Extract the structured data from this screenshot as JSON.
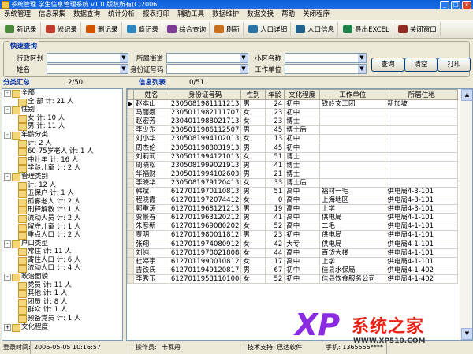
{
  "window": {
    "title": "系统管理 学生信息管理系统 v1.0 版权所有(C)2006"
  },
  "menu": [
    "系统管理",
    "信息采集",
    "数据查询",
    "统计分析",
    "报表打印",
    "辅助工具",
    "数据维护",
    "数据交换",
    "帮助",
    "关闭程序"
  ],
  "toolbar": [
    {
      "label": "新记录",
      "icon": "new-record-icon",
      "color": "#4a8a3a"
    },
    {
      "label": "修记录",
      "icon": "edit-record-icon",
      "color": "#c0392b"
    },
    {
      "label": "删记录",
      "icon": "delete-record-icon",
      "color": "#d35400"
    },
    {
      "label": "简记录",
      "icon": "brief-record-icon",
      "color": "#2e86c1"
    },
    {
      "label": "综合查询",
      "icon": "search-icon",
      "color": "#7d3c98"
    },
    {
      "label": "刷新",
      "icon": "refresh-icon",
      "color": "#ca6f1e"
    },
    {
      "label": "人口详细",
      "icon": "person-detail-icon",
      "color": "#2874a6"
    },
    {
      "label": "人口信息",
      "icon": "person-info-icon",
      "color": "#1f618d"
    },
    {
      "label": "导出EXCEL",
      "icon": "excel-icon",
      "color": "#1e8449"
    },
    {
      "label": "关闭窗口",
      "icon": "close-window-icon",
      "color": "#922b21"
    }
  ],
  "query": {
    "title": "快速查询",
    "fields": [
      {
        "label": "行政区划",
        "value": ""
      },
      {
        "label": "所属街道",
        "value": ""
      },
      {
        "label": "小区名称",
        "value": ""
      },
      {
        "label": "姓名",
        "value": ""
      },
      {
        "label": "身份证号码",
        "value": ""
      },
      {
        "label": "工作单位",
        "value": ""
      }
    ],
    "buttons": [
      "查询",
      "清空",
      "打印"
    ]
  },
  "tree_panel": {
    "title": "分类汇总",
    "count": "2/50"
  },
  "list_panel": {
    "title": "信息列表",
    "count": "0/51"
  },
  "tree": [
    {
      "label": "全部",
      "level": 0,
      "tog": "-"
    },
    {
      "label": "全 部  计: 21 人",
      "level": 1
    },
    {
      "label": "性别",
      "level": 0,
      "tog": "-"
    },
    {
      "label": "女  计: 10 人",
      "level": 1
    },
    {
      "label": "男  计: 11 人",
      "level": 1
    },
    {
      "label": "年龄分类",
      "level": 0,
      "tog": "-"
    },
    {
      "label": "计: 2 人",
      "level": 1
    },
    {
      "label": "60-75岁老人  计: 1 人",
      "level": 1
    },
    {
      "label": "中壮年  计: 16 人",
      "level": 1
    },
    {
      "label": "学龄儿童  计: 2 人",
      "level": 1
    },
    {
      "label": "管理类别",
      "level": 0,
      "tog": "-"
    },
    {
      "label": "计: 12 人",
      "level": 1
    },
    {
      "label": "五保户  计: 1 人",
      "level": 1
    },
    {
      "label": "孤寡老人  计: 2 人",
      "level": 1
    },
    {
      "label": "刑释解教  计: 1 人",
      "level": 1
    },
    {
      "label": "流动人员  计: 2 人",
      "level": 1
    },
    {
      "label": "留守儿童  计: 1 人",
      "level": 1
    },
    {
      "label": "重点人口  计: 2 人",
      "level": 1
    },
    {
      "label": "户口类型",
      "level": 0,
      "tog": "-"
    },
    {
      "label": "常住  计: 11 人",
      "level": 1
    },
    {
      "label": "寄住人口  计: 6 人",
      "level": 1
    },
    {
      "label": "流动人口  计: 4 人",
      "level": 1
    },
    {
      "label": "政治面貌",
      "level": 0,
      "tog": "-"
    },
    {
      "label": "党员  计: 11 人",
      "level": 1
    },
    {
      "label": "其他  计: 1 人",
      "level": 1
    },
    {
      "label": "团员  计: 8 人",
      "level": 1
    },
    {
      "label": "群众  计: 1 人",
      "level": 1
    },
    {
      "label": "预备党员  计: 1 人",
      "level": 1
    },
    {
      "label": "文化程度",
      "level": 0,
      "tog": "+"
    }
  ],
  "grid": {
    "columns": [
      "姓名",
      "身份证号码",
      "性别",
      "年龄",
      "文化程度",
      "工作单位",
      "所居住地"
    ],
    "rows": [
      [
        "赵本山",
        "230508198111121311",
        "男",
        "24",
        "初中",
        "铁岭文工团",
        "新加坡"
      ],
      [
        "马丽娜",
        "230501198211170722",
        "女",
        "23",
        "初中",
        "",
        ""
      ],
      [
        "赵宏芳",
        "230401198802171322",
        "女",
        "23",
        "博士",
        "",
        ""
      ],
      [
        "李少东",
        "230501198611250711",
        "男",
        "45",
        "博士后",
        "",
        ""
      ],
      [
        "刘小华",
        "230508199410201322",
        "女",
        "13",
        "初中",
        "",
        ""
      ],
      [
        "周杰伦",
        "230501198803191311",
        "男",
        "45",
        "初中",
        "",
        ""
      ],
      [
        "刘莉莉",
        "230501199412101322",
        "女",
        "51",
        "博士",
        "",
        ""
      ],
      [
        "周晓松",
        "230508199902191311",
        "男",
        "41",
        "博士",
        "",
        ""
      ],
      [
        "华福财",
        "230501199410260311",
        "男",
        "21",
        "博士",
        "",
        ""
      ],
      [
        "李晓华",
        "230508197912041322",
        "女",
        "33",
        "博士后",
        "",
        ""
      ],
      [
        "韩斌",
        "612701197011081310",
        "男",
        "51",
        "高中",
        "福村一毛",
        "供电局4-3-101"
      ],
      [
        "程晓霞",
        "612701197207441226",
        "女",
        "0",
        "高中",
        "上海地区",
        "供电局4-3-101"
      ],
      [
        "郭重涛",
        "612701196812121311",
        "男",
        "19",
        "高中",
        "上学",
        "供电局4-3-101"
      ],
      [
        "贾景春",
        "612701196312021214",
        "男",
        "41",
        "高中",
        "供电局",
        "供电局4-1-101"
      ],
      [
        "朱彦新",
        "612701196908020222",
        "女",
        "52",
        "高中",
        "二毛",
        "供电局4-1-101"
      ],
      [
        "贾明",
        "612701198001181219",
        "男",
        "23",
        "初中",
        "供电局",
        "供电局4-1-101"
      ],
      [
        "张翔",
        "612701197408091224",
        "女",
        "42",
        "大专",
        "供电局",
        "供电局4-1-101"
      ],
      [
        "刘纯",
        "612701197802180844",
        "女",
        "44",
        "高中",
        "百货大楼",
        "供电局4-1-101"
      ],
      [
        "杜婷宇",
        "612701199001081228",
        "女",
        "17",
        "高中",
        "上学",
        "供电局4-1-101"
      ],
      [
        "吉铁氏",
        "612701194912081711",
        "男",
        "67",
        "初中",
        "佳县水保局",
        "供电局4-1-402"
      ],
      [
        "李秀玉",
        "612701195311010045",
        "女",
        "52",
        "初中",
        "佳县饮食服务公司",
        "供电局4-1-402"
      ]
    ]
  },
  "status": {
    "login_label": "登录时间:",
    "login_time": "2006-05-05 10:16:57",
    "operator_label": "操作员:",
    "operator": "卡瓦丹",
    "tech_label": "技术支持: 巴达软件",
    "phone_label": "手机: 1365555****"
  },
  "watermark": {
    "logo": "XP",
    "text": "系统之家",
    "url": "WWW.XP510.COM"
  }
}
